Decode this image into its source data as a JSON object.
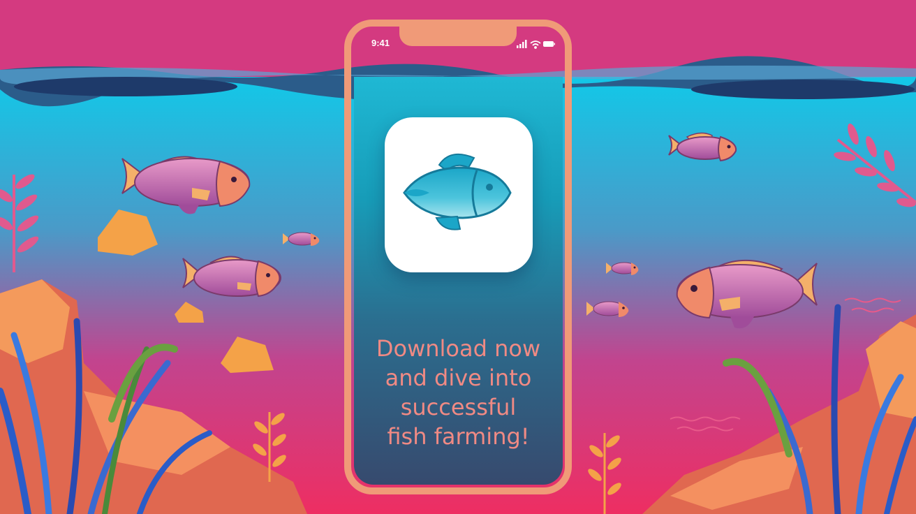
{
  "phone": {
    "status_time": "9:41",
    "signal_icon": "cellular-signal-icon",
    "wifi_icon": "wifi-icon",
    "battery_icon": "battery-icon"
  },
  "app": {
    "icon_name": "fish-app-icon",
    "icon_color": "#1ba6c8"
  },
  "cta": {
    "line1": "Download now",
    "line2": "and dive into",
    "line3": "successful",
    "line4": "fish farming!"
  },
  "colors": {
    "sky": "#d43a80",
    "water_top": "#12c8e8",
    "water_bottom": "#e8386a",
    "phone_frame": "#f09a78",
    "cta_text": "#f08a84"
  }
}
